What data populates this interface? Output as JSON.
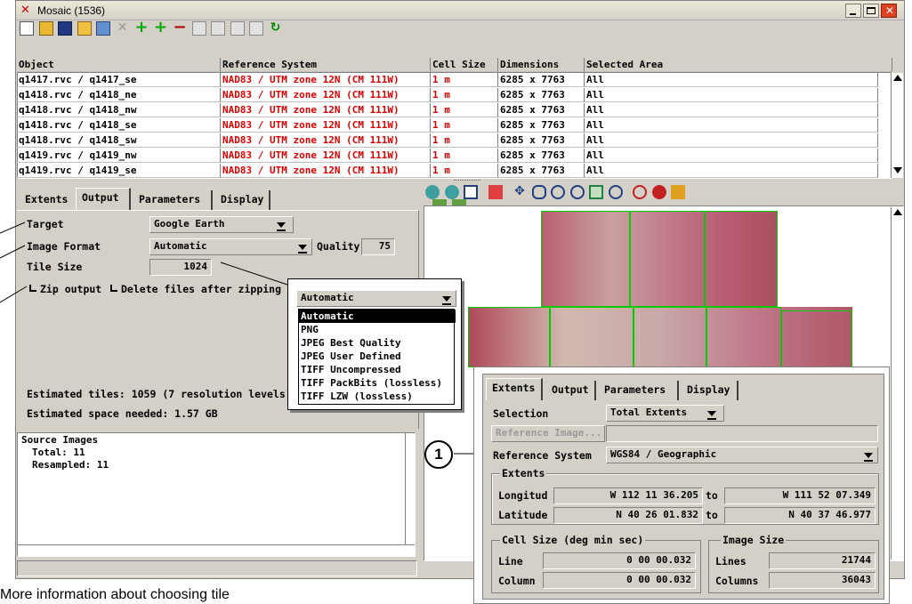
{
  "window": {
    "title": "Mosaic (1536)"
  },
  "table": {
    "headers": [
      "Object",
      "Reference System",
      "Cell Size",
      "Dimensions",
      "Selected Area"
    ],
    "rows": [
      {
        "object": "q1417.rvc / q1417_se",
        "ref": "NAD83 / UTM zone 12N (CM 111W)",
        "cell": "1 m",
        "dims": "6285 x 7763",
        "area": "All"
      },
      {
        "object": "q1418.rvc / q1418_ne",
        "ref": "NAD83 / UTM zone 12N (CM 111W)",
        "cell": "1 m",
        "dims": "6285 x 7763",
        "area": "All"
      },
      {
        "object": "q1418.rvc / q1418_nw",
        "ref": "NAD83 / UTM zone 12N (CM 111W)",
        "cell": "1 m",
        "dims": "6285 x 7763",
        "area": "All"
      },
      {
        "object": "q1418.rvc / q1418_se",
        "ref": "NAD83 / UTM zone 12N (CM 111W)",
        "cell": "1 m",
        "dims": "6285 x 7763",
        "area": "All"
      },
      {
        "object": "q1418.rvc / q1418_sw",
        "ref": "NAD83 / UTM zone 12N (CM 111W)",
        "cell": "1 m",
        "dims": "6285 x 7763",
        "area": "All"
      },
      {
        "object": "q1419.rvc / q1419_nw",
        "ref": "NAD83 / UTM zone 12N (CM 111W)",
        "cell": "1 m",
        "dims": "6285 x 7763",
        "area": "All"
      },
      {
        "object": "q1419.rvc / q1419_se",
        "ref": "NAD83 / UTM zone 12N (CM 111W)",
        "cell": "1 m",
        "dims": "6285 x 7763",
        "area": "All"
      }
    ]
  },
  "left_tabs": [
    "Extents",
    "Output",
    "Parameters",
    "Display"
  ],
  "output": {
    "target_label": "Target",
    "target_value": "Google Earth",
    "format_label": "Image Format",
    "format_value": "Automatic",
    "quality_label": "Quality",
    "quality_value": "75",
    "tile_label": "Tile Size",
    "tile_value": "1024",
    "zip_label": "Zip output",
    "delete_label": "Delete files after zipping",
    "estimated_tiles": "Estimated tiles: 1059 (7 resolution levels)",
    "estimated_space": "Estimated space needed: 1.57 GB"
  },
  "format_dropdown": {
    "selected": "Automatic",
    "options": [
      "Automatic",
      "PNG",
      "JPEG Best Quality",
      "JPEG User Defined",
      "TIFF Uncompressed",
      "TIFF PackBits (lossless)",
      "TIFF LZW (lossless)"
    ]
  },
  "source": {
    "title": "Source Images",
    "total": "Total: 11",
    "resampled": "Resampled: 11"
  },
  "extents_panel": {
    "tabs": [
      "Extents",
      "Output",
      "Parameters",
      "Display"
    ],
    "selection_label": "Selection",
    "selection_value": "Total Extents",
    "reference_image_button": "Reference Image...",
    "ref_system_label": "Reference System",
    "ref_system_value": "WGS84 / Geographic",
    "extents_group": "Extents",
    "longitude_label": "Longitud",
    "longitude_from": "W 112 11 36.205",
    "longitude_to": "W 111 52 07.349",
    "latitude_label": "Latitude",
    "latitude_from": "N 40 26 01.832",
    "latitude_to": "N 40 37 46.977",
    "to_label": "to",
    "cellsize_group": "Cell Size (deg min sec)",
    "line_label": "Line",
    "line_value": "0 00 00.032",
    "column_label": "Column",
    "column_value": "0 00 00.032",
    "imagesize_group": "Image Size",
    "lines_label": "Lines",
    "lines_value": "21744",
    "columns_label": "Columns",
    "columns_value": "36043"
  },
  "callout": {
    "number": "1"
  },
  "caption": "More information about choosing tile",
  "colors": {
    "red_text": "#e00000",
    "titlebar": "#d4d0c8",
    "selection": "#000000",
    "tile_outline": "#00cc00"
  }
}
